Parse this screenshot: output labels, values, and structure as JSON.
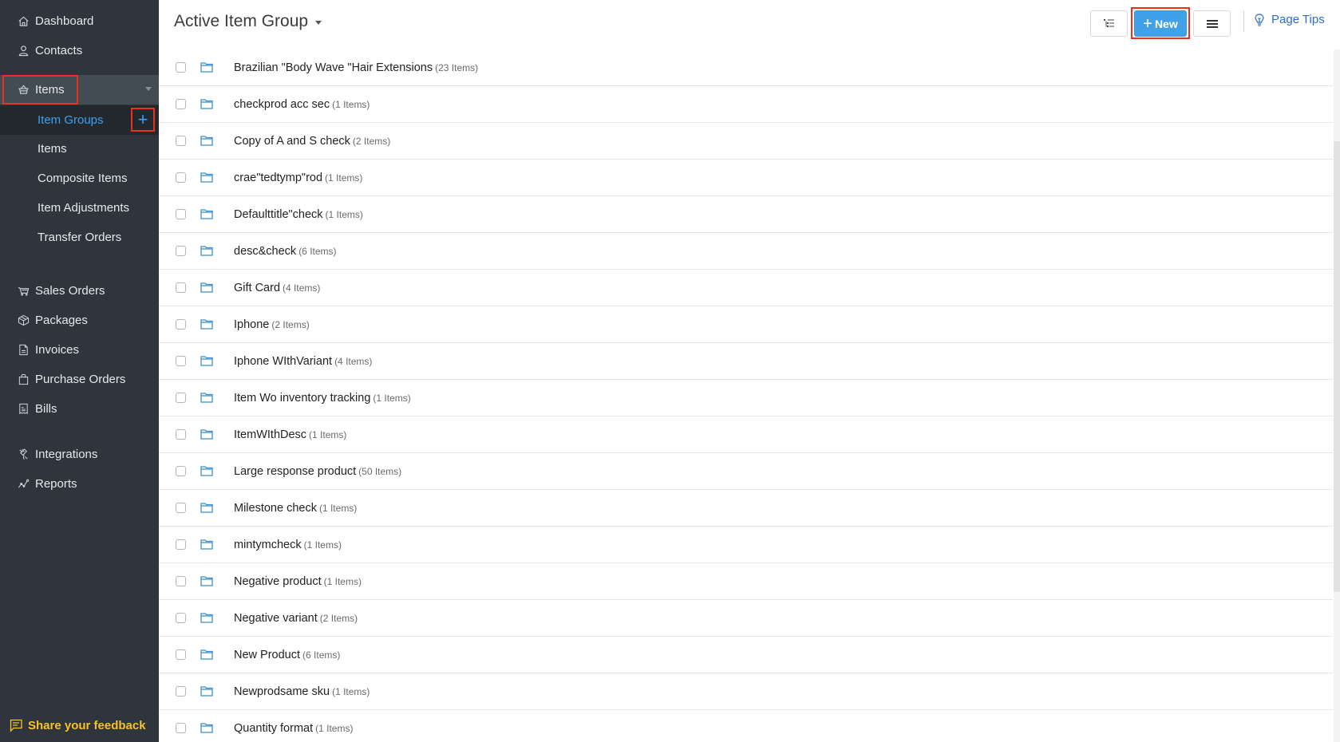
{
  "sidebar": {
    "nav": [
      {
        "label": "Dashboard",
        "icon": "home-icon"
      },
      {
        "label": "Contacts",
        "icon": "user-icon"
      },
      {
        "label": "Items",
        "icon": "basket-icon"
      }
    ],
    "items_submenu": [
      {
        "label": "Item Groups",
        "active": true
      },
      {
        "label": "Items"
      },
      {
        "label": "Composite Items"
      },
      {
        "label": "Item Adjustments"
      },
      {
        "label": "Transfer Orders"
      }
    ],
    "nav2": [
      {
        "label": "Sales Orders",
        "icon": "cart-icon"
      },
      {
        "label": "Packages",
        "icon": "package-icon"
      },
      {
        "label": "Invoices",
        "icon": "invoice-icon"
      },
      {
        "label": "Purchase Orders",
        "icon": "bag-icon"
      },
      {
        "label": "Bills",
        "icon": "bill-icon"
      }
    ],
    "nav3": [
      {
        "label": "Integrations",
        "icon": "plug-icon"
      },
      {
        "label": "Reports",
        "icon": "chart-line-icon"
      }
    ],
    "add_symbol": "+",
    "feedback_label": "Share your feedback"
  },
  "header": {
    "title": "Active Item Group",
    "new_label": "New",
    "new_symbol": "+",
    "page_tips_label": "Page Tips"
  },
  "colors": {
    "sidebar_bg": "#2f353c",
    "accent_blue": "#40a0e8",
    "active_link": "#3aa1f2",
    "highlight_red": "#e8321e",
    "feedback_yellow": "#f5c228",
    "link_blue": "#2a6fc8"
  },
  "item_groups": [
    {
      "name": "Brazilian \"Body Wave \"Hair Extensions",
      "count": "(23 Items)"
    },
    {
      "name": "checkprod acc sec",
      "count": "(1 Items)"
    },
    {
      "name": "Copy of A and S check",
      "count": "(2 Items)"
    },
    {
      "name": "crae\"tedtymp\"rod",
      "count": "(1 Items)"
    },
    {
      "name": "Defaulttitle\"check",
      "count": "(1 Items)"
    },
    {
      "name": "desc&check",
      "count": "(6 Items)"
    },
    {
      "name": "Gift Card",
      "count": "(4 Items)"
    },
    {
      "name": "Iphone",
      "count": "(2 Items)"
    },
    {
      "name": "Iphone WIthVariant",
      "count": "(4 Items)"
    },
    {
      "name": "Item Wo inventory tracking",
      "count": "(1 Items)"
    },
    {
      "name": "ItemWIthDesc",
      "count": "(1 Items)"
    },
    {
      "name": "Large response product",
      "count": "(50 Items)"
    },
    {
      "name": "Milestone check",
      "count": "(1 Items)"
    },
    {
      "name": "mintymcheck",
      "count": "(1 Items)"
    },
    {
      "name": "Negative product",
      "count": "(1 Items)"
    },
    {
      "name": "Negative variant",
      "count": "(2 Items)"
    },
    {
      "name": "New Product",
      "count": "(6 Items)"
    },
    {
      "name": "Newprodsame sku",
      "count": "(1 Items)"
    },
    {
      "name": "Quantity format",
      "count": "(1 Items)"
    }
  ]
}
